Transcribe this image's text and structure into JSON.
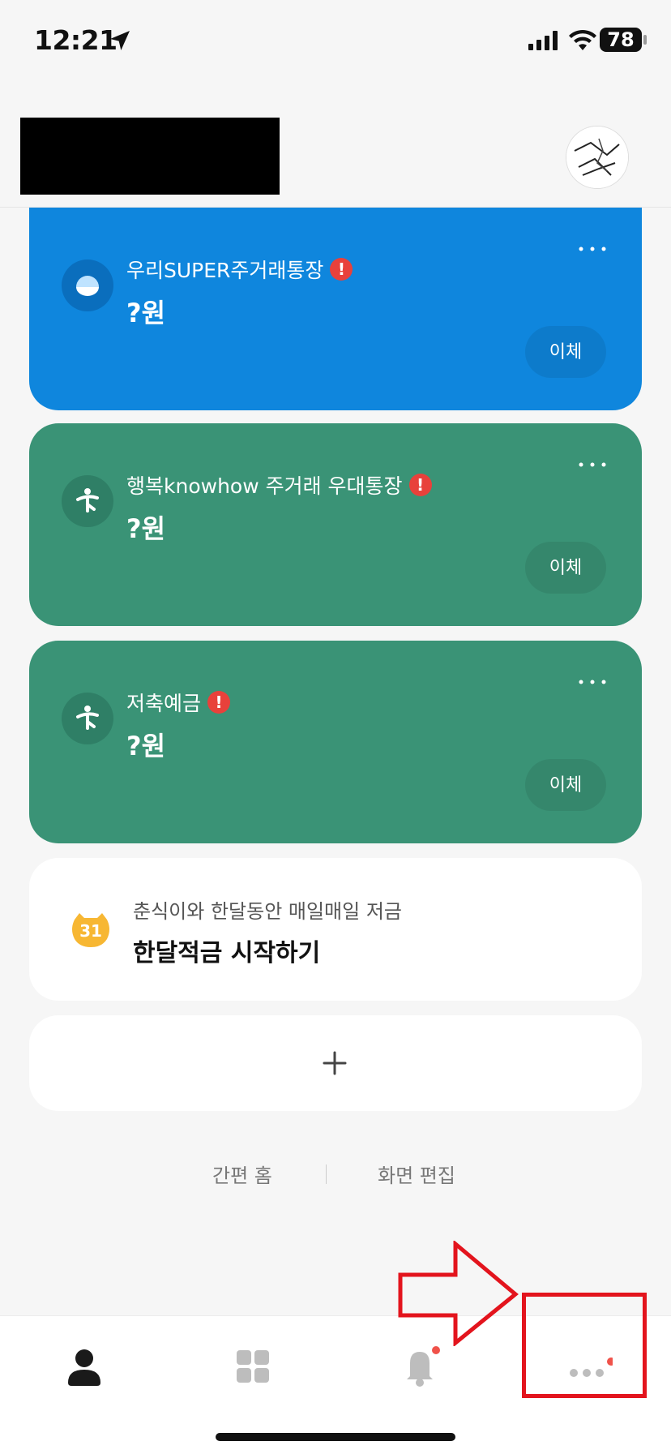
{
  "status_bar": {
    "time": "12:21",
    "battery": "78"
  },
  "accounts": [
    {
      "name": "우리SUPER주거래통장",
      "balance": "?원",
      "action": "이체",
      "color": "#0f86dd"
    },
    {
      "name": "행복knowhow 주거래 우대통장",
      "balance": "?원",
      "action": "이체",
      "color": "#3a9376"
    },
    {
      "name": "저축예금",
      "balance": "?원",
      "action": "이체",
      "color": "#3a9376"
    }
  ],
  "promo": {
    "subtitle": "춘식이와 한달동안 매일매일 저금",
    "title": "한달적금 시작하기",
    "badge": "31"
  },
  "footer_links": {
    "simple_home": "간편 홈",
    "edit_screen": "화면 편집"
  },
  "tabbar": {
    "items": [
      "person-icon",
      "grid-icon",
      "bell-icon",
      "more-icon"
    ],
    "annotation_color": "#e3141d"
  }
}
